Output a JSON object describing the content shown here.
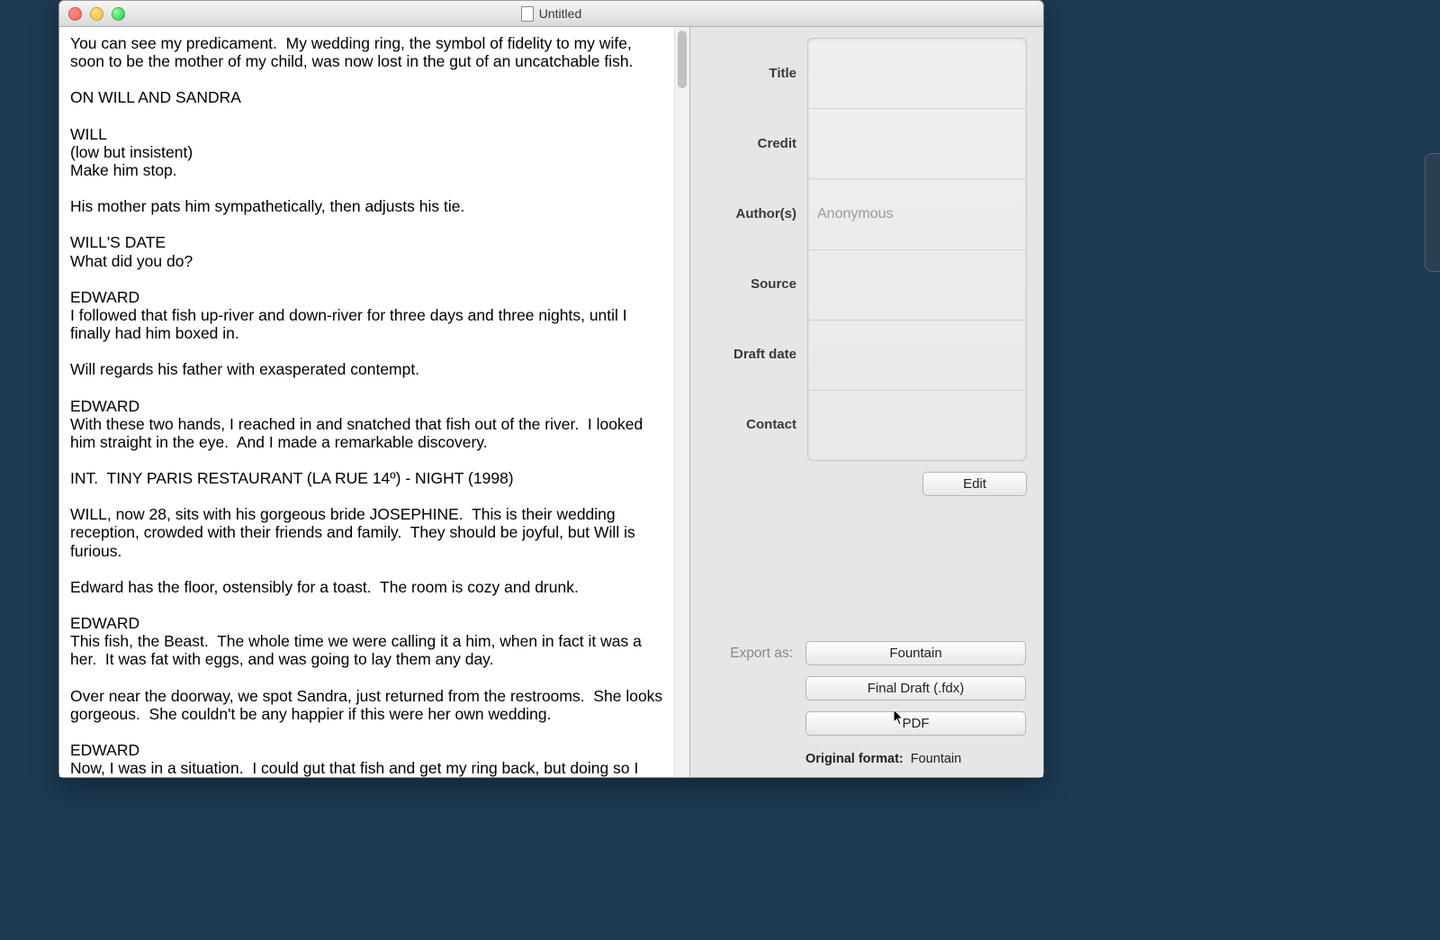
{
  "window": {
    "title": "Untitled"
  },
  "script": {
    "text": "You can see my predicament.  My wedding ring, the symbol of fidelity to my wife, soon to be the mother of my child, was now lost in the gut of an uncatchable fish.\n\nON WILL AND SANDRA\n\nWILL\n(low but insistent)\nMake him stop.\n\nHis mother pats him sympathetically, then adjusts his tie.\n\nWILL'S DATE\nWhat did you do?\n\nEDWARD\nI followed that fish up-river and down-river for three days and three nights, until I finally had him boxed in.\n\nWill regards his father with exasperated contempt.\n\nEDWARD\nWith these two hands, I reached in and snatched that fish out of the river.  I looked him straight in the eye.  And I made a remarkable discovery.\n\nINT.  TINY PARIS RESTAURANT (LA RUE 14º) - NIGHT (1998)\n\nWILL, now 28, sits with his gorgeous bride JOSEPHINE.  This is their wedding reception, crowded with their friends and family.  They should be joyful, but Will is furious.\n\nEdward has the floor, ostensibly for a toast.  The room is cozy and drunk.\n\nEDWARD\nThis fish, the Beast.  The whole time we were calling it a him, when in fact it was a her.  It was fat with eggs, and was going to lay them any day.\n\nOver near the doorway, we spot Sandra, just returned from the restrooms.  She looks gorgeous.  She couldn't be any happier if this were her own wedding.\n\nEDWARD\nNow, I was in a situation.  I could gut that fish and get my ring back, but doing so I would be killing the smartest catfish in the Ashton River, soon to be mother of a hundred others."
  },
  "meta": {
    "labels": {
      "title": "Title",
      "credit": "Credit",
      "authors": "Author(s)",
      "source": "Source",
      "draft_date": "Draft date",
      "contact": "Contact"
    },
    "values": {
      "title": "",
      "credit": "",
      "authors_placeholder": "Anonymous",
      "source": "",
      "draft_date": "",
      "contact": ""
    },
    "edit_button": "Edit"
  },
  "export": {
    "label": "Export as:",
    "buttons": {
      "fountain": "Fountain",
      "fdx": "Final Draft (.fdx)",
      "pdf": "PDF"
    },
    "original_label": "Original format:",
    "original_value": "Fountain"
  }
}
